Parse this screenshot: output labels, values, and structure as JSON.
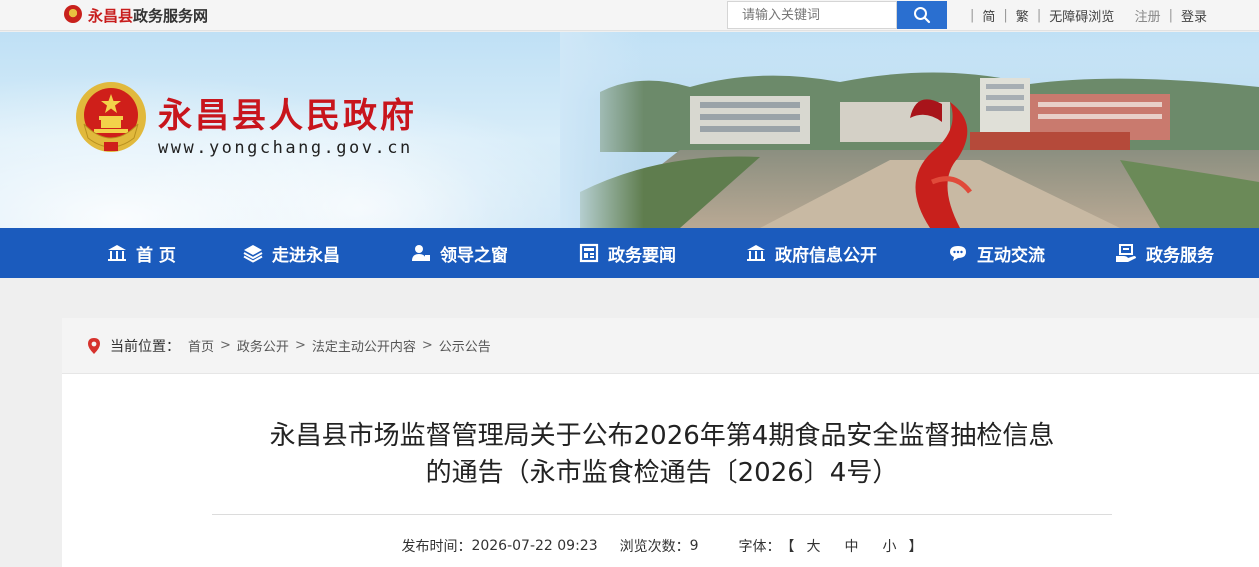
{
  "topbar": {
    "site_name_red": "永昌县",
    "site_name_rest": "政务服务网",
    "search_placeholder": "请输入关键词",
    "links": [
      "简",
      "繁",
      "无障碍浏览"
    ],
    "register": "注册",
    "login": "登录"
  },
  "banner": {
    "title": "永昌县人民政府",
    "url": "www.yongchang.gov.cn"
  },
  "nav": [
    {
      "label": "首 页",
      "icon": "home-icon"
    },
    {
      "label": "走进永昌",
      "icon": "layers-icon"
    },
    {
      "label": "领导之窗",
      "icon": "leader-icon"
    },
    {
      "label": "政务要闻",
      "icon": "news-icon"
    },
    {
      "label": "政府信息公开",
      "icon": "government-icon"
    },
    {
      "label": "互动交流",
      "icon": "chat-icon"
    },
    {
      "label": "政务服务",
      "icon": "service-icon"
    }
  ],
  "breadcrumb": {
    "label": "当前位置：",
    "items": [
      "首页",
      "政务公开",
      "法定主动公开内容",
      "公示公告"
    ]
  },
  "article": {
    "title_line1": "永昌县市场监督管理局关于公布2026年第4期食品安全监督抽检信息",
    "title_line2": "的通告（永市监食检通告〔2026〕4号）",
    "publish_label": "发布时间：",
    "publish_time": "2026-07-22 09:23",
    "views_label": "浏览次数：",
    "views": "9",
    "font_label": "字体：",
    "bracket_open": "【",
    "font_large": "大",
    "font_medium": "中",
    "font_small": "小",
    "bracket_close": "】"
  },
  "colors": {
    "nav_bg": "#1b5bbd",
    "title_red": "#c8151c",
    "search_btn": "#2a6fd0"
  }
}
